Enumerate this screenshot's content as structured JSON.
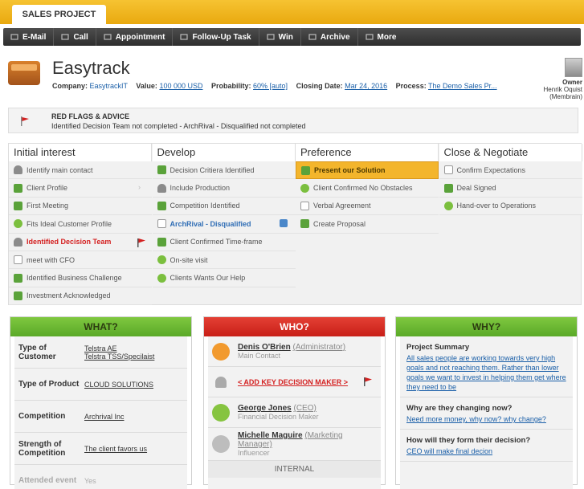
{
  "tab": "SALES PROJECT",
  "toolbar": [
    {
      "icon": "mail-icon",
      "label": "E-Mail"
    },
    {
      "icon": "phone-icon",
      "label": "Call"
    },
    {
      "icon": "calendar-icon",
      "label": "Appointment"
    },
    {
      "icon": "task-icon",
      "label": "Follow-Up Task"
    },
    {
      "icon": "win-icon",
      "label": "Win"
    },
    {
      "icon": "archive-icon",
      "label": "Archive"
    },
    {
      "icon": "menu-icon",
      "label": "More"
    }
  ],
  "project": {
    "title": "Easytrack",
    "company_label": "Company:",
    "company": "EasytrackIT",
    "value_label": "Value:",
    "value": "100 000 USD",
    "probability_label": "Probability:",
    "probability": "60% [auto]",
    "closing_label": "Closing Date:",
    "closing": "Mar 24, 2016",
    "process_label": "Process:",
    "process": "The Demo Sales Pr..."
  },
  "owner": {
    "label": "Owner",
    "name": "Henrik Oquist",
    "org": "(Membrain)"
  },
  "flags": {
    "title": "RED FLAGS & ADVICE",
    "text": "Identified Decision Team not completed - ArchRival - Disqualified not completed"
  },
  "stages": [
    {
      "name": "Initial interest",
      "items": [
        {
          "label": "Identify main contact",
          "icon": "person",
          "state": ""
        },
        {
          "label": "Client Profile",
          "icon": "doc",
          "state": "",
          "chevron": true
        },
        {
          "label": "First Meeting",
          "icon": "doc",
          "state": ""
        },
        {
          "label": "Fits Ideal Customer Profile",
          "icon": "circle",
          "state": ""
        },
        {
          "label": "Identified Decision Team",
          "icon": "person",
          "state": "red",
          "flag": true
        },
        {
          "label": "meet with CFO",
          "icon": "chk",
          "state": ""
        },
        {
          "label": "Identified Business Challenge",
          "icon": "doc",
          "state": ""
        },
        {
          "label": "Investment Acknowledged",
          "icon": "doc",
          "state": ""
        }
      ]
    },
    {
      "name": "Develop",
      "items": [
        {
          "label": "Decision Critiera Identified",
          "icon": "doc",
          "state": ""
        },
        {
          "label": "Include Production",
          "icon": "person",
          "state": ""
        },
        {
          "label": "Competition Identified",
          "icon": "doc",
          "state": ""
        },
        {
          "label": "ArchRival - Disqualified",
          "icon": "chk",
          "state": "blue",
          "puzzle": true
        },
        {
          "label": "Client Confirmed Time-frame",
          "icon": "doc",
          "state": ""
        },
        {
          "label": "On-site visit",
          "icon": "circle",
          "state": ""
        },
        {
          "label": "Clients Wants Our Help",
          "icon": "circle",
          "state": ""
        }
      ]
    },
    {
      "name": "Preference",
      "items": [
        {
          "label": "Present our Solution",
          "icon": "doc",
          "state": "active"
        },
        {
          "label": "Client Confirmed No Obstacles",
          "icon": "circle",
          "state": ""
        },
        {
          "label": "Verbal Agreement",
          "icon": "chk",
          "state": ""
        },
        {
          "label": "Create Proposal",
          "icon": "doc",
          "state": ""
        }
      ]
    },
    {
      "name": "Close & Negotiate",
      "items": [
        {
          "label": "Confirm Expectations",
          "icon": "chk",
          "state": ""
        },
        {
          "label": "Deal Signed",
          "icon": "doc",
          "state": ""
        },
        {
          "label": "Hand-over to Operations",
          "icon": "circle",
          "state": ""
        }
      ]
    }
  ],
  "what": {
    "title": "WHAT?",
    "rows": [
      {
        "label": "Type of Customer",
        "value": "Telstra AE\nTelstra TSS/Specilaist"
      },
      {
        "label": "Type of Product",
        "value": "CLOUD SOLUTIONS"
      },
      {
        "label": "Competition",
        "value": "Archrival Inc"
      },
      {
        "label": "Strength of Competition",
        "value": "The client favors us"
      },
      {
        "label": "Attended event",
        "value": "Yes",
        "dim": true
      }
    ]
  },
  "who": {
    "title": "WHO?",
    "people": [
      {
        "name": "Denis O'Brien",
        "title": "(Administrator)",
        "role": "Main Contact",
        "color": "#f29a2e"
      },
      {
        "name": "< ADD KEY DECISION MAKER >",
        "title": "",
        "role": "",
        "color": "",
        "add": true
      },
      {
        "name": "George Jones",
        "title": "(CEO)",
        "role": "Financial Decision Maker",
        "color": "#86c440"
      },
      {
        "name": "Michelle Maguire",
        "title": "(Marketing Manager)",
        "role": "Influencer",
        "color": "#bdbdbd"
      }
    ],
    "internal": "INTERNAL"
  },
  "why": {
    "title": "WHY?",
    "rows": [
      {
        "q": "Project Summary",
        "a": "All sales people are working towards very high goals and not reaching them. Rather than lower goals we want to invest in helping them get where they need to be"
      },
      {
        "q": "Why are they changing now?",
        "a": "Need more money, why now? why change?"
      },
      {
        "q": "How will they form their decision?",
        "a": "CEO will make final decion"
      }
    ]
  },
  "colors": {
    "accent": "#f3b52c",
    "danger": "#d42020",
    "success": "#6bb33e",
    "link": "#1a5fa8"
  }
}
